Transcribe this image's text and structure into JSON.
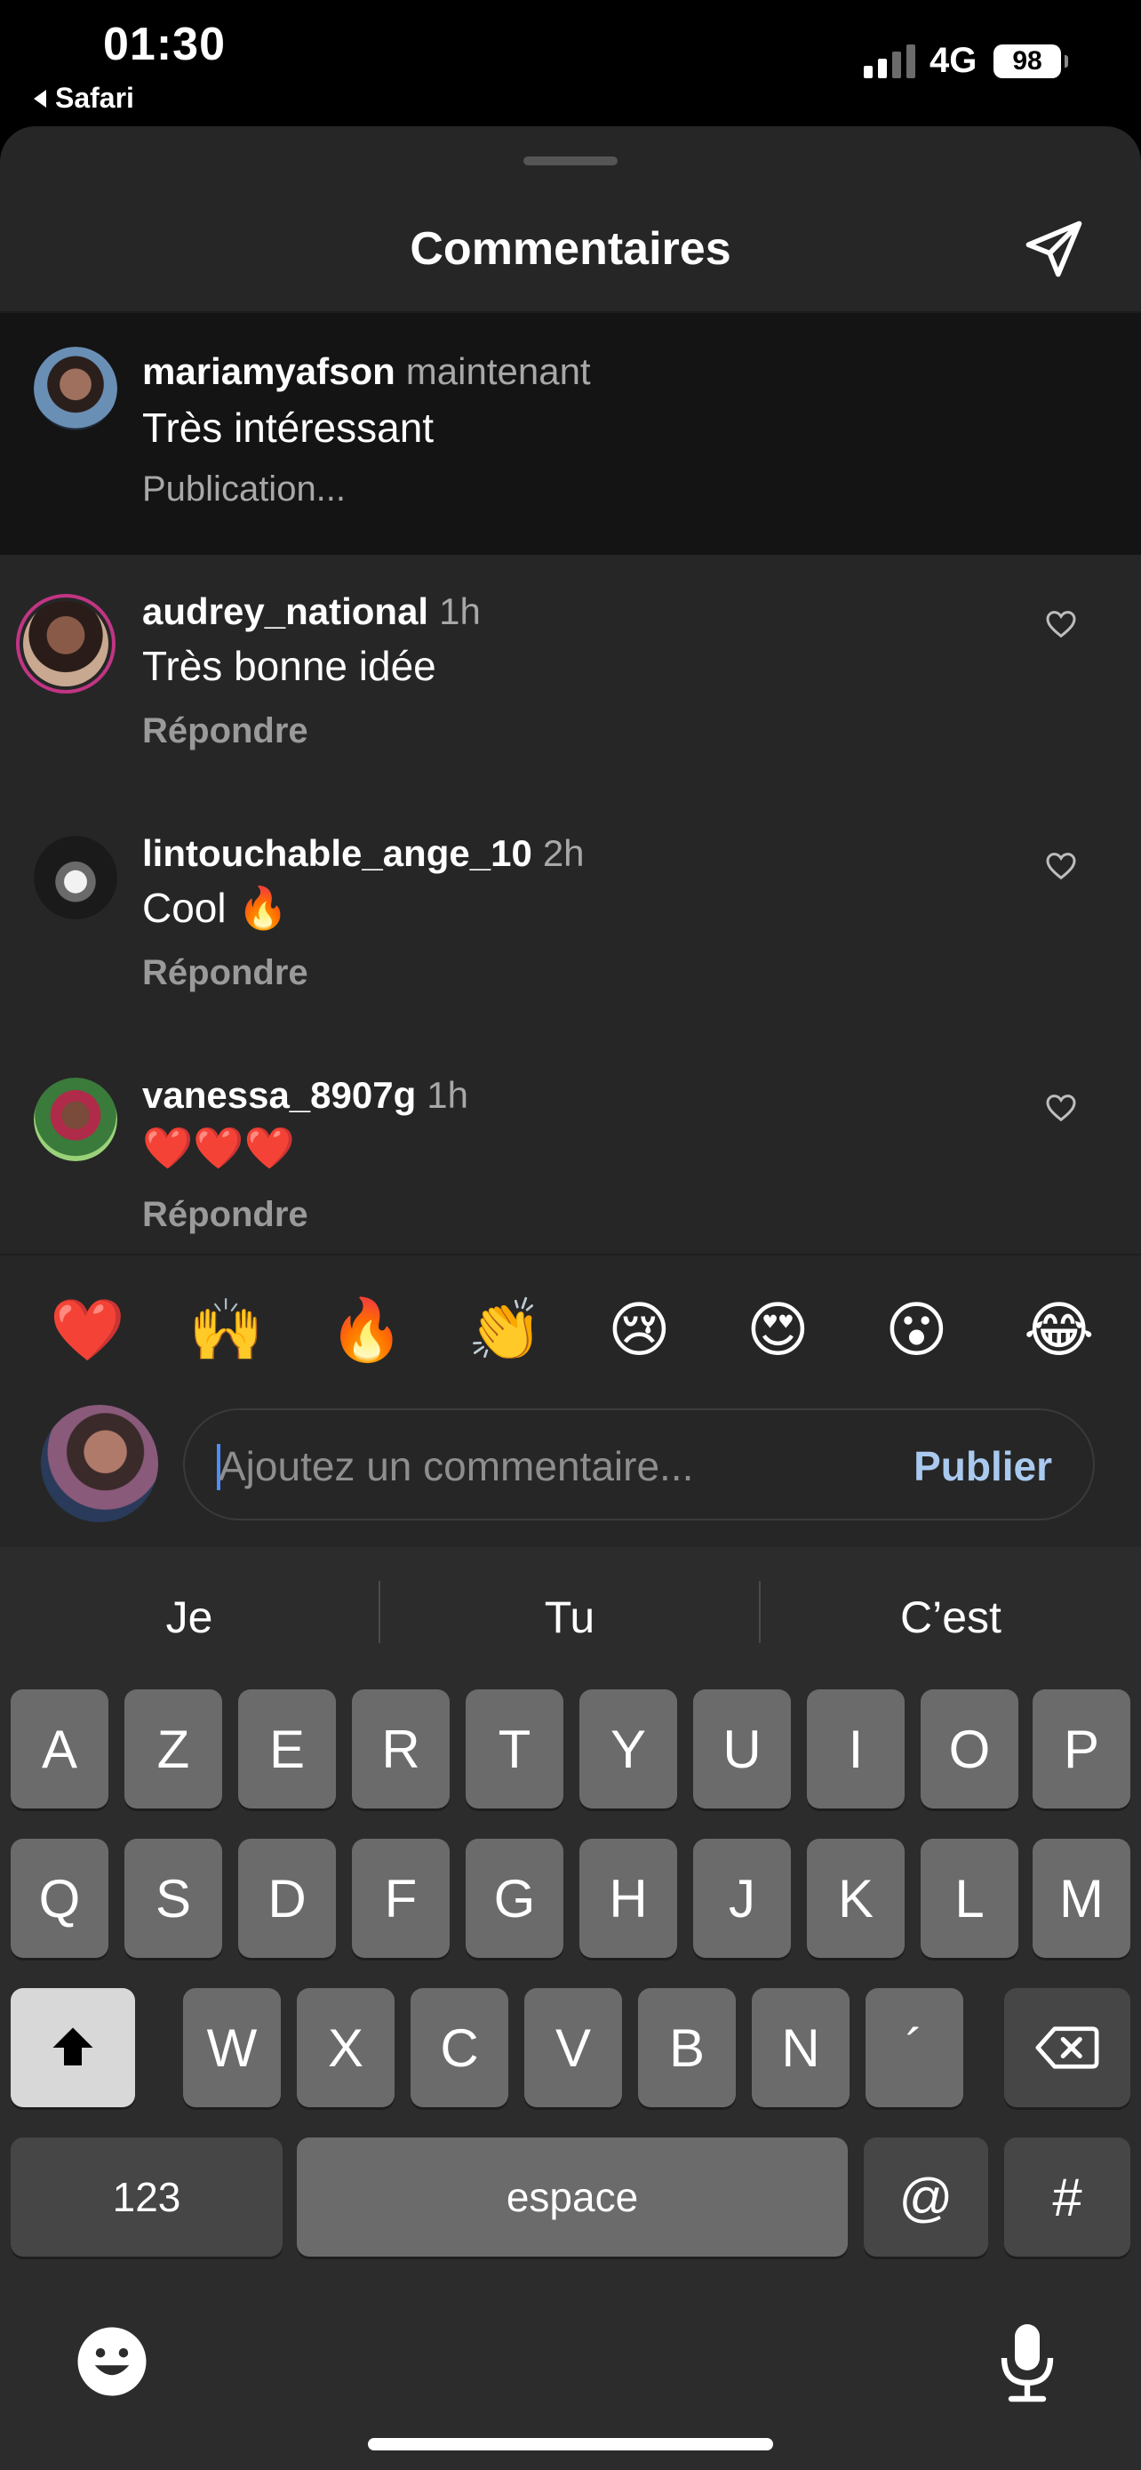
{
  "status": {
    "time": "01:30",
    "back_app": "Safari",
    "network": "4G",
    "battery": "98"
  },
  "sheet": {
    "title": "Commentaires"
  },
  "comments": [
    {
      "user": "mariamyafson",
      "when": "maintenant",
      "text": "Très intéressant",
      "sub": "Publication..."
    },
    {
      "user": "audrey_national",
      "when": "1h",
      "text": "Très bonne idée",
      "sub": "Répondre"
    },
    {
      "user": "lintouchable_ange_10",
      "when": "2h",
      "text": "Cool 🔥",
      "sub": "Répondre"
    },
    {
      "user": "vanessa_8907g",
      "when": "1h",
      "text": "❤️❤️❤️",
      "sub": "Répondre"
    }
  ],
  "reactions": [
    "❤️",
    "🙌",
    "🔥",
    "👏",
    "😢",
    "😍",
    "😮",
    "😂"
  ],
  "composer": {
    "placeholder": "Ajoutez un commentaire...",
    "publish": "Publier"
  },
  "keyboard": {
    "suggestions": [
      "Je",
      "Tu",
      "C’est"
    ],
    "row1": [
      "A",
      "Z",
      "E",
      "R",
      "T",
      "Y",
      "U",
      "I",
      "O",
      "P"
    ],
    "row2": [
      "Q",
      "S",
      "D",
      "F",
      "G",
      "H",
      "J",
      "K",
      "L",
      "M"
    ],
    "row3": [
      "W",
      "X",
      "C",
      "V",
      "B",
      "N",
      "´"
    ],
    "numbers": "123",
    "space": "espace",
    "at": "@",
    "hash": "#"
  },
  "icons": [
    "send-icon",
    "heart-icon",
    "shift-icon",
    "backspace-icon",
    "emoji-keyboard-icon",
    "microphone-icon"
  ]
}
